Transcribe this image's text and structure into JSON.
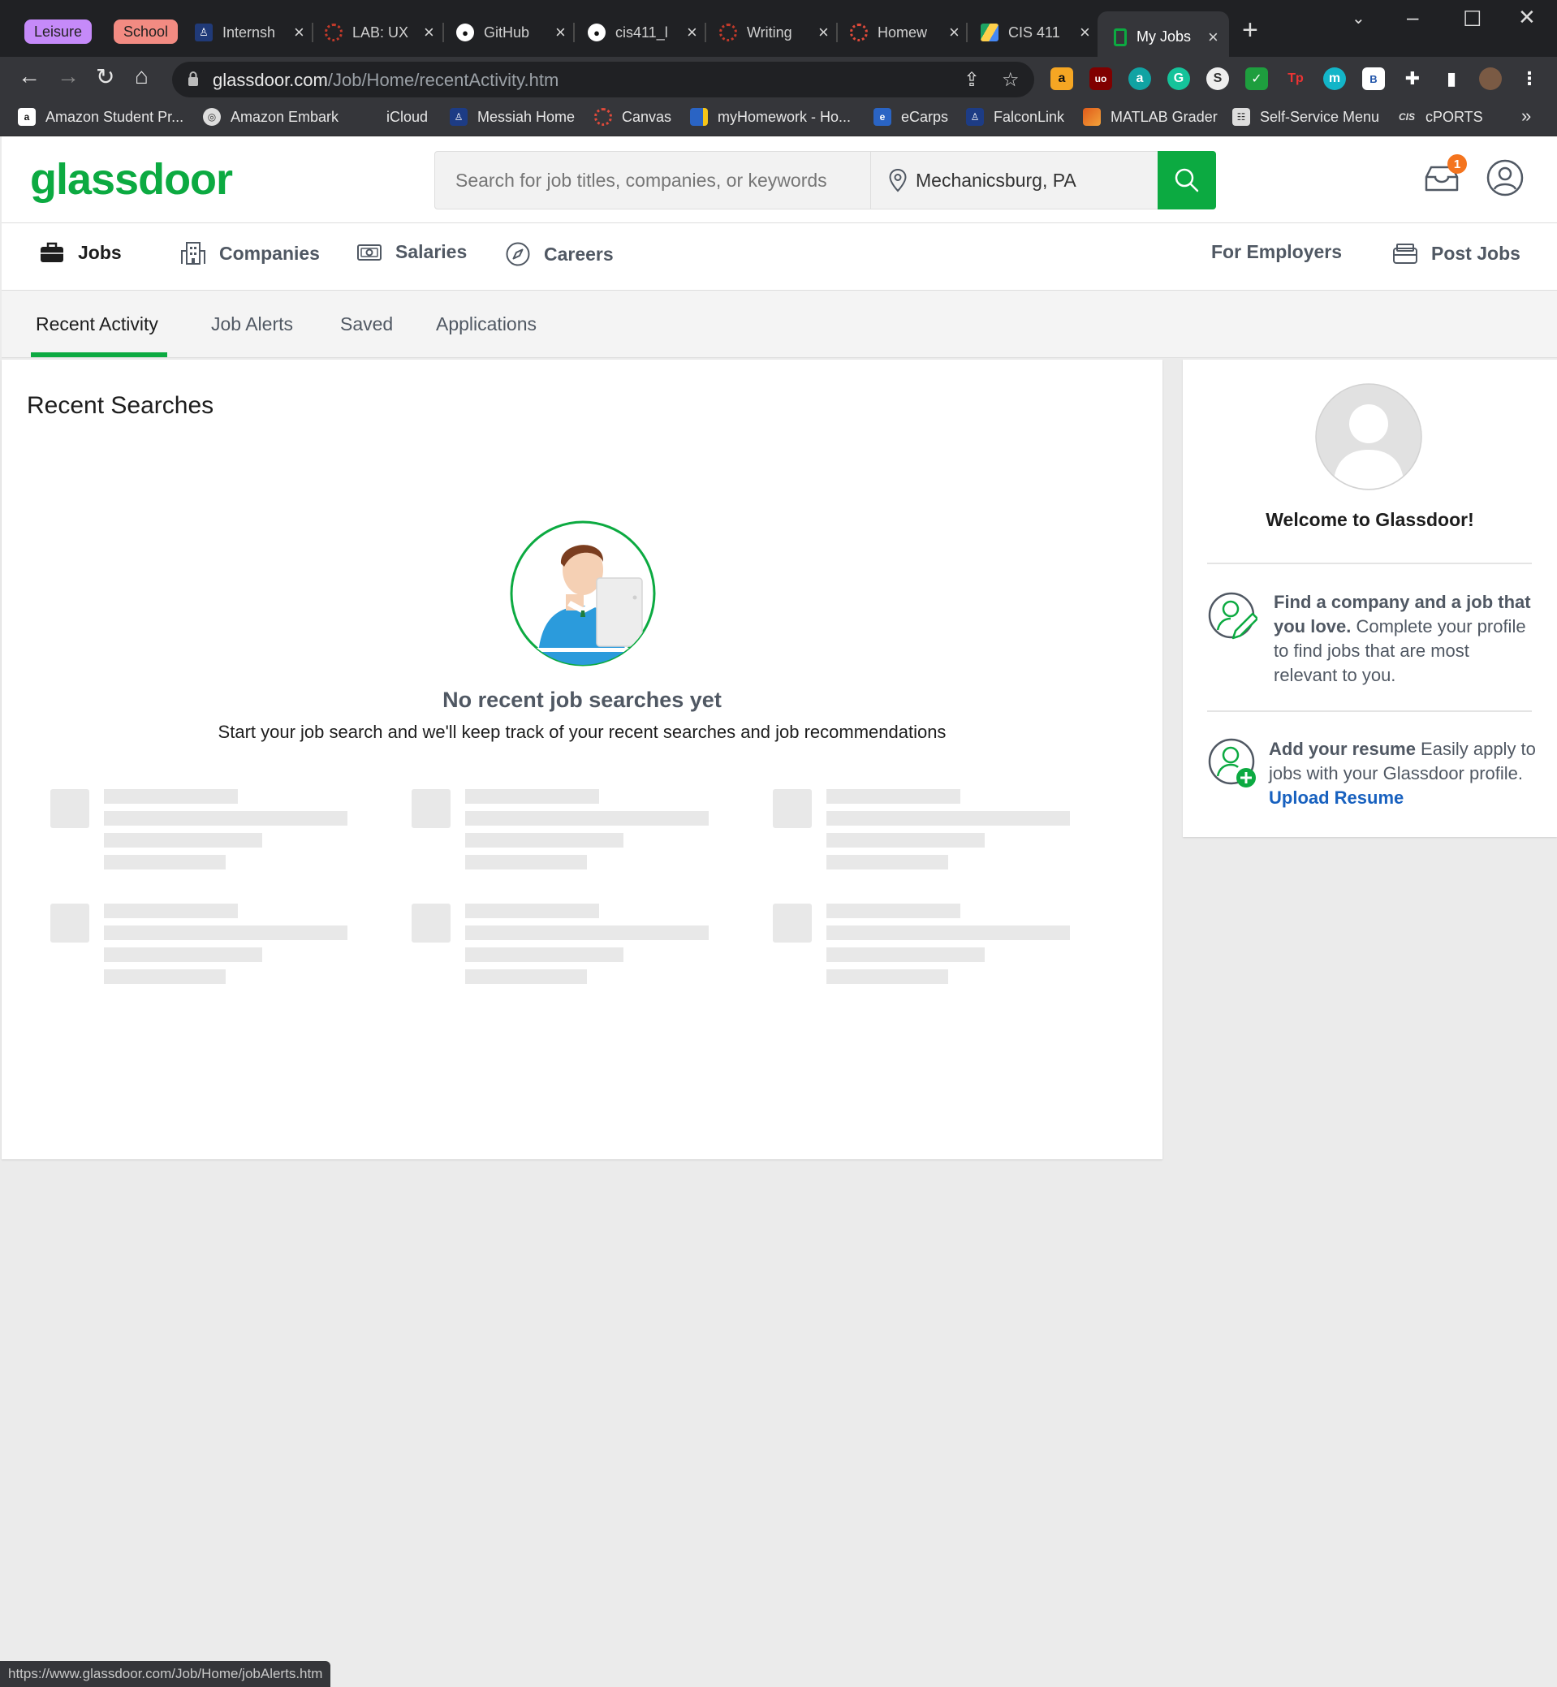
{
  "browser": {
    "tab_groups": [
      {
        "label": "Leisure",
        "color": "#c58af9"
      },
      {
        "label": "School",
        "color": "#f28b82"
      }
    ],
    "tabs": [
      {
        "title": "Internsh",
        "icon": "person-icon"
      },
      {
        "title": "LAB: UX",
        "icon": "canvas-icon"
      },
      {
        "title": "GitHub",
        "icon": "github-icon"
      },
      {
        "title": "cis411_l",
        "icon": "github-icon"
      },
      {
        "title": "Writing",
        "icon": "canvas-icon"
      },
      {
        "title": "Homew",
        "icon": "canvas-icon"
      },
      {
        "title": "CIS 411",
        "icon": "drive-icon"
      },
      {
        "title": "My Jobs",
        "icon": "glassdoor-icon",
        "active": true
      }
    ],
    "url_host": "glassdoor.com",
    "url_path": "/Job/Home/recentActivity.htm",
    "bookmarks": [
      {
        "label": "Amazon Student Pr...",
        "icon": "amazon-icon"
      },
      {
        "label": "Amazon Embark",
        "icon": "globe-icon"
      },
      {
        "label": "iCloud",
        "icon": "apple-icon"
      },
      {
        "label": "Messiah Home",
        "icon": "messiah-icon"
      },
      {
        "label": "Canvas",
        "icon": "canvas-icon"
      },
      {
        "label": "myHomework - Ho...",
        "icon": "homework-icon"
      },
      {
        "label": "eCarps",
        "icon": "ecarps-icon"
      },
      {
        "label": "FalconLink",
        "icon": "messiah-icon"
      },
      {
        "label": "MATLAB Grader",
        "icon": "matlab-icon"
      },
      {
        "label": "Self-Service Menu",
        "icon": "self-service-icon"
      },
      {
        "label": "cPORTS",
        "icon": "cis-icon"
      }
    ],
    "bookmarks_more": "»",
    "status_url": "https://www.glassdoor.com/Job/Home/jobAlerts.htm"
  },
  "glassdoor": {
    "logo": "glassdoor",
    "brand_color": "#0caa41",
    "search": {
      "keyword_placeholder": "Search for job titles, companies, or keywords",
      "location_value": "Mechanicsburg, PA"
    },
    "inbox_badge": "1",
    "nav": {
      "jobs": "Jobs",
      "companies": "Companies",
      "salaries": "Salaries",
      "careers": "Careers",
      "for_employers": "For Employers",
      "post_jobs": "Post Jobs"
    },
    "subtabs": {
      "recent_activity": "Recent Activity",
      "job_alerts": "Job Alerts",
      "saved": "Saved",
      "applications": "Applications"
    },
    "recent": {
      "title": "Recent Searches",
      "empty_title": "No recent job searches yet",
      "empty_sub": "Start your job search and we'll keep track of your recent searches and job recommendations"
    },
    "sidebar": {
      "welcome": "Welcome to Glassdoor!",
      "tip1_bold": "Find a company and a job that you love.",
      "tip1_text": " Complete your profile to find jobs that are most relevant to you.",
      "tip2_bold": "Add your resume",
      "tip2_text": " Easily apply to jobs with your Glassdoor profile. ",
      "tip2_link": "Upload Resume"
    }
  }
}
